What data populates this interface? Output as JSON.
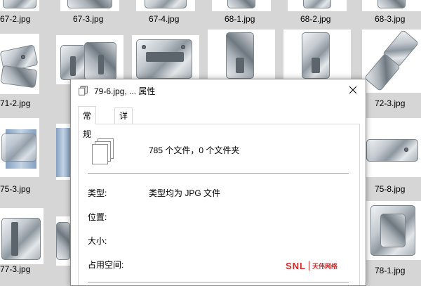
{
  "background_files": {
    "row1": [
      "67-2.jpg",
      "67-3.jpg",
      "67-4.jpg",
      "68-1.jpg",
      "68-2.jpg",
      "68-3.jpg"
    ],
    "row2": [
      "71-2.jpg",
      "72-3.jpg"
    ],
    "row3": [
      "75-3.jpg",
      "75-8.jpg"
    ],
    "row4": [
      "77-3.jpg",
      "78-1.jpg"
    ]
  },
  "dialog": {
    "title": "79-6.jpg, ... 属性",
    "close_glyph": "✕",
    "tabs": [
      {
        "label": "常规",
        "active": true
      },
      {
        "label": "详细信息",
        "active": false
      }
    ],
    "summary": "785 个文件，0 个文件夹",
    "properties": [
      {
        "label": "类型:",
        "value": "类型均为 JPG 文件"
      },
      {
        "label": "位置:",
        "value": ""
      },
      {
        "label": "大小:",
        "value": ""
      },
      {
        "label": "占用空间:",
        "value": ""
      }
    ]
  },
  "watermark": {
    "main": "SNL",
    "sub": "天伟网络"
  },
  "icons": {
    "title": "multiple-files-icon",
    "summary": "multiple-files-icon",
    "close": "close-icon"
  },
  "colors": {
    "accent": "#d22a2a",
    "dialog_bg": "#ffffff",
    "explorer_bg": "#d6d6d6"
  }
}
